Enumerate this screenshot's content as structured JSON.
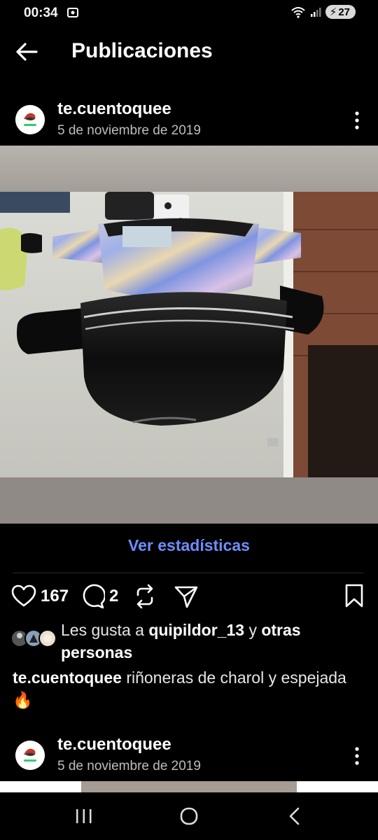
{
  "status": {
    "time": "00:34",
    "battery": "27"
  },
  "header": {
    "title": "Publicaciones"
  },
  "post": {
    "username": "te.cuentoquee",
    "date": "5 de noviembre de 2019",
    "stats_link": "Ver estadísticas",
    "likes": "167",
    "comments": "2",
    "liked_by_prefix": "Les gusta a",
    "liked_by_user": "quipildor_13",
    "liked_by_mid": "y",
    "liked_by_others": "otras personas",
    "caption_user": "te.cuentoquee",
    "caption_text": "riñoneras de charol y espejada🔥"
  },
  "next_post": {
    "username": "te.cuentoquee",
    "date": "5 de noviembre de 2019"
  },
  "colors": {
    "background": "#000000",
    "link": "#6e8dff",
    "secondary_text": "#bdbdbd"
  },
  "icons": [
    "back-arrow-icon",
    "more-vertical-icon",
    "heart-icon",
    "comment-icon",
    "repost-icon",
    "share-icon",
    "bookmark-icon",
    "recents-icon",
    "home-icon",
    "back-nav-icon"
  ]
}
